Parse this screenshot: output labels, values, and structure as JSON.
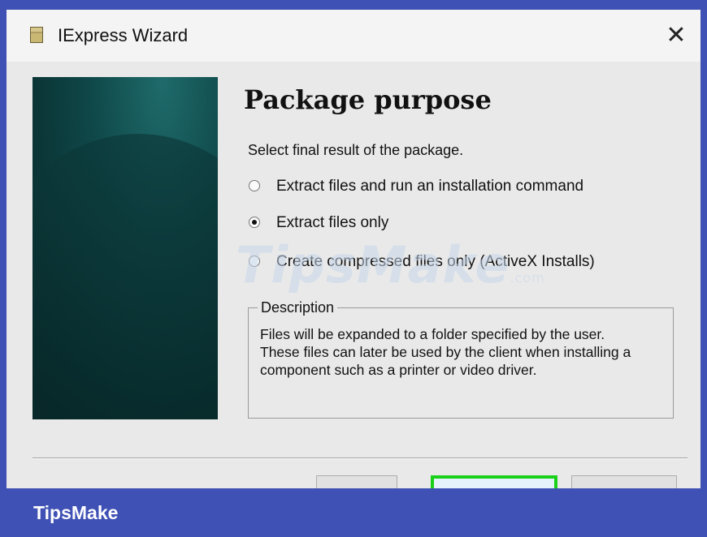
{
  "window": {
    "title": "IExpress Wizard",
    "close_glyph": "✕",
    "icon": "iexpress-app-icon"
  },
  "page": {
    "heading": "Package purpose",
    "prompt": "Select final result of the package.",
    "options": [
      {
        "label": "Extract files and run an installation command",
        "selected": false
      },
      {
        "label": "Extract files only",
        "selected": true
      },
      {
        "label": "Create compressed files only (ActiveX Installs)",
        "selected": false
      }
    ],
    "description": {
      "legend": "Description",
      "text": "Files will be expanded to a folder specified by the user. These files can later be used by the client when installing a component such as a printer or video driver."
    }
  },
  "watermark": {
    "main": "TipsMake",
    "suffix": ".com"
  },
  "footer": {
    "brand": "TipsMake"
  },
  "colors": {
    "frame_blue": "#3f51b5",
    "highlight_green": "#19d119",
    "side_panel_teal": "#0f4748"
  }
}
